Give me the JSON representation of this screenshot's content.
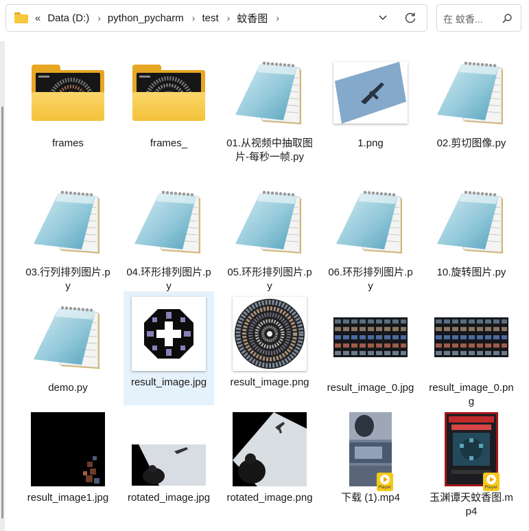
{
  "address_bar": {
    "overflow_chevron": "«",
    "crumbs": [
      "Data (D:)",
      "python_pycharm",
      "test",
      "蚊香图"
    ],
    "separator": "›"
  },
  "search": {
    "placeholder": "在 蚊香..."
  },
  "items": [
    {
      "name": "frames",
      "type": "folder"
    },
    {
      "name": "frames_",
      "type": "folder"
    },
    {
      "name": "01.从视频中抽取图片-每秒一帧.py",
      "type": "py"
    },
    {
      "name": "1.png",
      "type": "image"
    },
    {
      "name": "02.剪切图像.py",
      "type": "py"
    },
    {
      "name": "03.行列排列图片.py",
      "type": "py"
    },
    {
      "name": "04.环形排列图片.py",
      "type": "py"
    },
    {
      "name": "05.环形排列图片.py",
      "type": "py"
    },
    {
      "name": "06.环形排列图片.py",
      "type": "py"
    },
    {
      "name": "10.旋转图片.py",
      "type": "py"
    },
    {
      "name": "demo.py",
      "type": "py"
    },
    {
      "name": "result_image.jpg",
      "type": "image",
      "selected": true
    },
    {
      "name": "result_image.png",
      "type": "image"
    },
    {
      "name": "result_image_0.jpg",
      "type": "image"
    },
    {
      "name": "result_image_0.png",
      "type": "image"
    },
    {
      "name": "result_image1.jpg",
      "type": "image"
    },
    {
      "name": "rotated_image.jpg",
      "type": "image"
    },
    {
      "name": "rotated_image.png",
      "type": "image"
    },
    {
      "name": "下载 (1).mp4",
      "type": "video"
    },
    {
      "name": "玉渊谭天蚊香图.mp4",
      "type": "video"
    }
  ],
  "video_badge_text": "Player",
  "colors": {
    "folder": "#f4c13a",
    "selection": "#e5f1fb",
    "player_badge": "#f6c91a"
  }
}
